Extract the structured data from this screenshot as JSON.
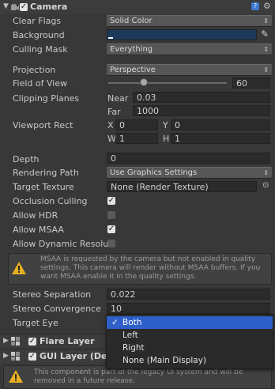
{
  "camera": {
    "title": "Camera",
    "clear_flags": {
      "label": "Clear Flags",
      "value": "Solid Color"
    },
    "background": {
      "label": "Background",
      "color": "#1e3a5a"
    },
    "culling_mask": {
      "label": "Culling Mask",
      "value": "Everything"
    },
    "projection": {
      "label": "Projection",
      "value": "Perspective"
    },
    "fov": {
      "label": "Field of View",
      "value": "60",
      "slider_fraction": 0.3
    },
    "clipping": {
      "label": "Clipping Planes",
      "near_label": "Near",
      "near": "0.03",
      "far_label": "Far",
      "far": "1000"
    },
    "viewport": {
      "label": "Viewport Rect",
      "x_label": "X",
      "x": "0",
      "y_label": "Y",
      "y": "0",
      "w_label": "W",
      "w": "1",
      "h_label": "H",
      "h": "1"
    },
    "depth": {
      "label": "Depth",
      "value": "0"
    },
    "rendering_path": {
      "label": "Rendering Path",
      "value": "Use Graphics Settings"
    },
    "target_texture": {
      "label": "Target Texture",
      "value": "None (Render Texture)"
    },
    "occlusion_culling": {
      "label": "Occlusion Culling",
      "checked": true
    },
    "allow_hdr": {
      "label": "Allow HDR",
      "checked": false
    },
    "allow_msaa": {
      "label": "Allow MSAA",
      "checked": true
    },
    "allow_dynamic": {
      "label": "Allow Dynamic Resolu",
      "checked": false
    },
    "msaa_warning": "MSAA is requested by the camera but not enabled in quality settings. This camera will render without MSAA buffers. If you want MSAA enable it in the quality settings.",
    "stereo_separation": {
      "label": "Stereo Separation",
      "value": "0.022"
    },
    "stereo_convergence": {
      "label": "Stereo Convergence",
      "value": "10"
    },
    "target_eye": {
      "label": "Target Eye"
    }
  },
  "dropdown": {
    "options": [
      "Both",
      "Left",
      "Right",
      "None (Main Display)"
    ],
    "selected": "Both"
  },
  "flare_layer": {
    "title": "Flare Layer"
  },
  "gui_layer": {
    "title": "GUI Layer (Dep",
    "warning": "This component is part of the legacy UI system and will be removed in a future release."
  },
  "colors": {
    "accent": "#2f5fc8",
    "panel": "#383838"
  }
}
